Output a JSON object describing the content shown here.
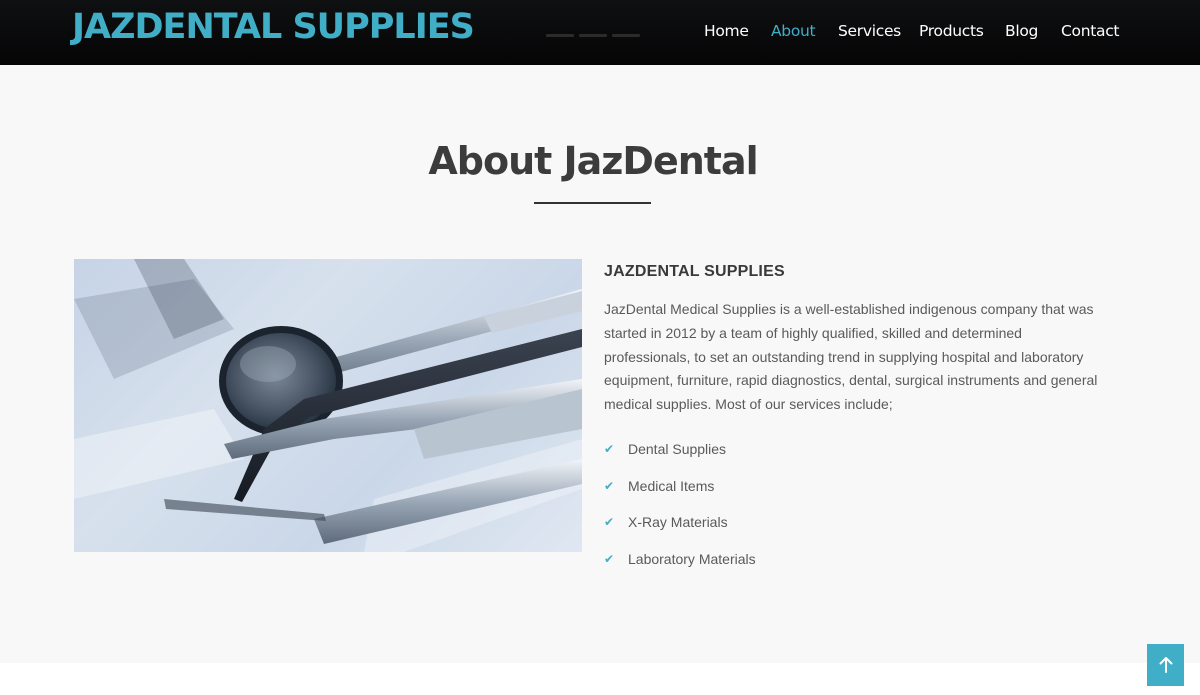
{
  "colors": {
    "accent": "#41aec7",
    "nav_bg": "#0a0a0b",
    "section_bg": "#f8f8f8",
    "heading": "#3c3c3c",
    "body_text": "#5a5a5a"
  },
  "header": {
    "brand": "JAZDENTAL SUPPLIES",
    "nav": [
      {
        "label": "Home",
        "active": false
      },
      {
        "label": "About",
        "active": true
      },
      {
        "label": "Services",
        "active": false
      },
      {
        "label": "Products",
        "active": false
      },
      {
        "label": "Blog",
        "active": false
      },
      {
        "label": "Contact",
        "active": false
      }
    ]
  },
  "about": {
    "title": "About JazDental",
    "subtitle": "JAZDENTAL SUPPLIES",
    "paragraph": "JazDental Medical Supplies is a well-established indigenous company that was started in 2012 by a team of highly qualified, skilled and determined professionals, to set an outstanding trend in supplying hospital and laboratory equipment, furniture, rapid diagnostics, dental, surgical instruments and general medical supplies. Most of our services include;",
    "services": [
      "Dental Supplies",
      "Medical Items",
      "X-Ray Materials",
      "Laboratory Materials"
    ],
    "image_icon": "dental-instruments-photo"
  },
  "scroll_top": {
    "icon": "arrow-up-icon"
  }
}
